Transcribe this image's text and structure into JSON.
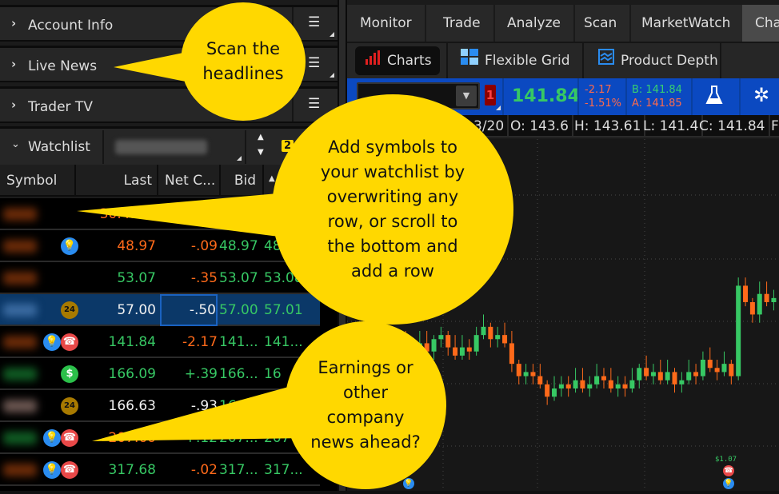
{
  "left_panel": {
    "sections": [
      {
        "label": "Account Info",
        "icon": "chevron-right-icon"
      },
      {
        "label": "Live News",
        "icon": "chevron-right-icon"
      },
      {
        "label": "Trader TV",
        "icon": "chevron-right-icon"
      }
    ],
    "watchlist": {
      "label": "Watchlist",
      "badge": "2",
      "columns": [
        "Symbol",
        "Last",
        "Net C...",
        "Bid"
      ],
      "rows": [
        {
          "icons": [],
          "last": "30.4100",
          "last_color": "orange",
          "net": "",
          "net_color": "orange",
          "bid": "",
          "ask": "",
          "symbol_tint": "#6a2a08"
        },
        {
          "icons": [
            "bulb"
          ],
          "last": "48.97",
          "last_color": "orange",
          "net": "-.09",
          "net_color": "orange",
          "bid": "48.97",
          "ask": "48.9",
          "symbol_tint": "#6a2a08"
        },
        {
          "icons": [],
          "last": "53.07",
          "last_color": "green",
          "net": "-.35",
          "net_color": "orange",
          "bid": "53.07",
          "ask": "53.08",
          "symbol_tint": "#6a2a08"
        },
        {
          "icons": [
            "24"
          ],
          "last": "57.00",
          "last_color": "white",
          "net": "-.50",
          "net_color": "white",
          "bid": "57.00",
          "ask": "57.01",
          "symbol_tint": "#3a6aa0",
          "selected": true
        },
        {
          "icons": [
            "bulb",
            "phone"
          ],
          "last": "141.84",
          "last_color": "green",
          "net": "-2.17",
          "net_color": "orange",
          "bid": "141...",
          "ask": "141...",
          "symbol_tint": "#6a2a08"
        },
        {
          "icons": [
            "dollar"
          ],
          "last": "166.09",
          "last_color": "green",
          "net": "+.39",
          "net_color": "green",
          "bid": "166...",
          "ask": "16",
          "symbol_tint": "#0f5a22"
        },
        {
          "icons": [
            "24"
          ],
          "last": "166.63",
          "last_color": "white",
          "net": "-.93",
          "net_color": "white",
          "bid": "166",
          "ask": "",
          "symbol_tint": "#6a5550"
        },
        {
          "icons": [
            "bulb",
            "phone"
          ],
          "last": "207.60",
          "last_color": "orange",
          "net": "+.12",
          "net_color": "green",
          "bid": "207...",
          "ask": "207",
          "symbol_tint": "#0f5a22"
        },
        {
          "icons": [
            "bulb",
            "phone"
          ],
          "last": "317.68",
          "last_color": "green",
          "net": "-.02",
          "net_color": "orange",
          "bid": "317...",
          "ask": "317...",
          "symbol_tint": "#6a2a08"
        }
      ]
    }
  },
  "main": {
    "tabs": [
      "Monitor",
      "Trade",
      "Analyze",
      "Scan",
      "MarketWatch",
      "Cha"
    ],
    "active_tab": 5,
    "subtabs": [
      "Charts",
      "Flexible Grid",
      "Product Depth"
    ],
    "quote": {
      "badge": "1",
      "last": "141.84",
      "change": "-2.17",
      "change_pct": "-1.51%",
      "bid": "B: 141.84",
      "ask": "A: 141.85"
    },
    "ohlc": [
      "3/20",
      "O: 143.6",
      "H: 143.61",
      "L: 141.4",
      "C: 141.84",
      "F"
    ],
    "chart": {
      "dividend_label": "$1.07"
    }
  },
  "callouts": {
    "news": "Scan the headlines",
    "watchlist": "Add symbols to your watchlist by overwriting any row, or scroll to the bottom and add a row",
    "earnings": "Earnings or other company news ahead?"
  },
  "colors": {
    "up": "#37c864",
    "down": "#ff6a1a",
    "quote_bar": "#0b49c1",
    "callout": "#ffd800"
  }
}
